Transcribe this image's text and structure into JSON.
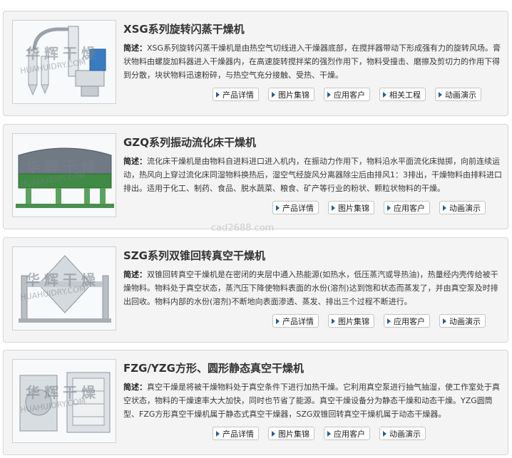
{
  "watermark": "cad2688.com",
  "thumb_watermark": {
    "cn": "华辉干燥",
    "en": "HUAHUIDRY.COM"
  },
  "desc_label": "简述：",
  "products": [
    {
      "title": "XSG系列旋转闪蒸干燥机",
      "desc": "XSG系列旋转闪蒸干燥机是由热空气切线进入干燥器底部，在搅拌器带动下形成强有力的旋转风场。膏状物料由螺旋加料器进入干燥器内，在高速旋转搅拌桨的强烈作用下，物料受撞击、磨擦及剪切力的作用下得到分散，块状物料迅速粉碎，与热空气充分接触、受热、干燥。",
      "buttons": [
        "产品详情",
        "图片集锦",
        "应用客户",
        "相关工程",
        "动画演示"
      ]
    },
    {
      "title": "GZQ系列振动流化床干燥机",
      "desc": "流化床干燥机是由物料自进料进口进入机内，在振动力作用下，物料沿水平面流化床抛掷，向前连续运动，热风向上穿过流化床同湿物料换热后，湿空气经旋风分离器除尘后由排风1：3排出，干燥物料由排料进口排出。适用于化工、制药、食品、脱水蔬菜、粮食、矿产等行业的粉状、颗粒状物料的干燥。",
      "buttons": [
        "产品详情",
        "图片集锦",
        "应用客户",
        "动画演示"
      ]
    },
    {
      "title": "SZG系列双锥回转真空干燥机",
      "desc": "双锥回转真空干燥机是在密闭的夹层中通入热能源(如热水，低压蒸汽或导热油)，热量经内壳传给被干燥物料。物料处于真空状态，蒸汽压下降使物料表面的水份(溶剂)达到饱和状态而蒸发了，并由真空泵及时排出回收。物料内部的水份(溶剂)不断地向表面渗透、蒸发、排出三个过程不断进行。",
      "buttons": [
        "产品详情",
        "图片集锦",
        "应用客户",
        "动画演示"
      ]
    },
    {
      "title": "FZG/YZG方形、圆形静态真空干燥机",
      "desc": "真空干燥是将被干燥物料处于真空条件下进行加热干燥。它利用真空泵进行抽气抽湿，使工作室处于真空状态，物料的干燥速率大大加快，同时也节省了能源。真空干燥设备分为静态干燥和动态干燥。YZG圆筒型、FZG方形真空干燥机属于静态式真空干燥器，SZG双锥回转真空干燥机属于动态干燥器。",
      "buttons": [
        "产品详情",
        "图片集锦",
        "应用客户",
        "动画演示"
      ]
    }
  ]
}
